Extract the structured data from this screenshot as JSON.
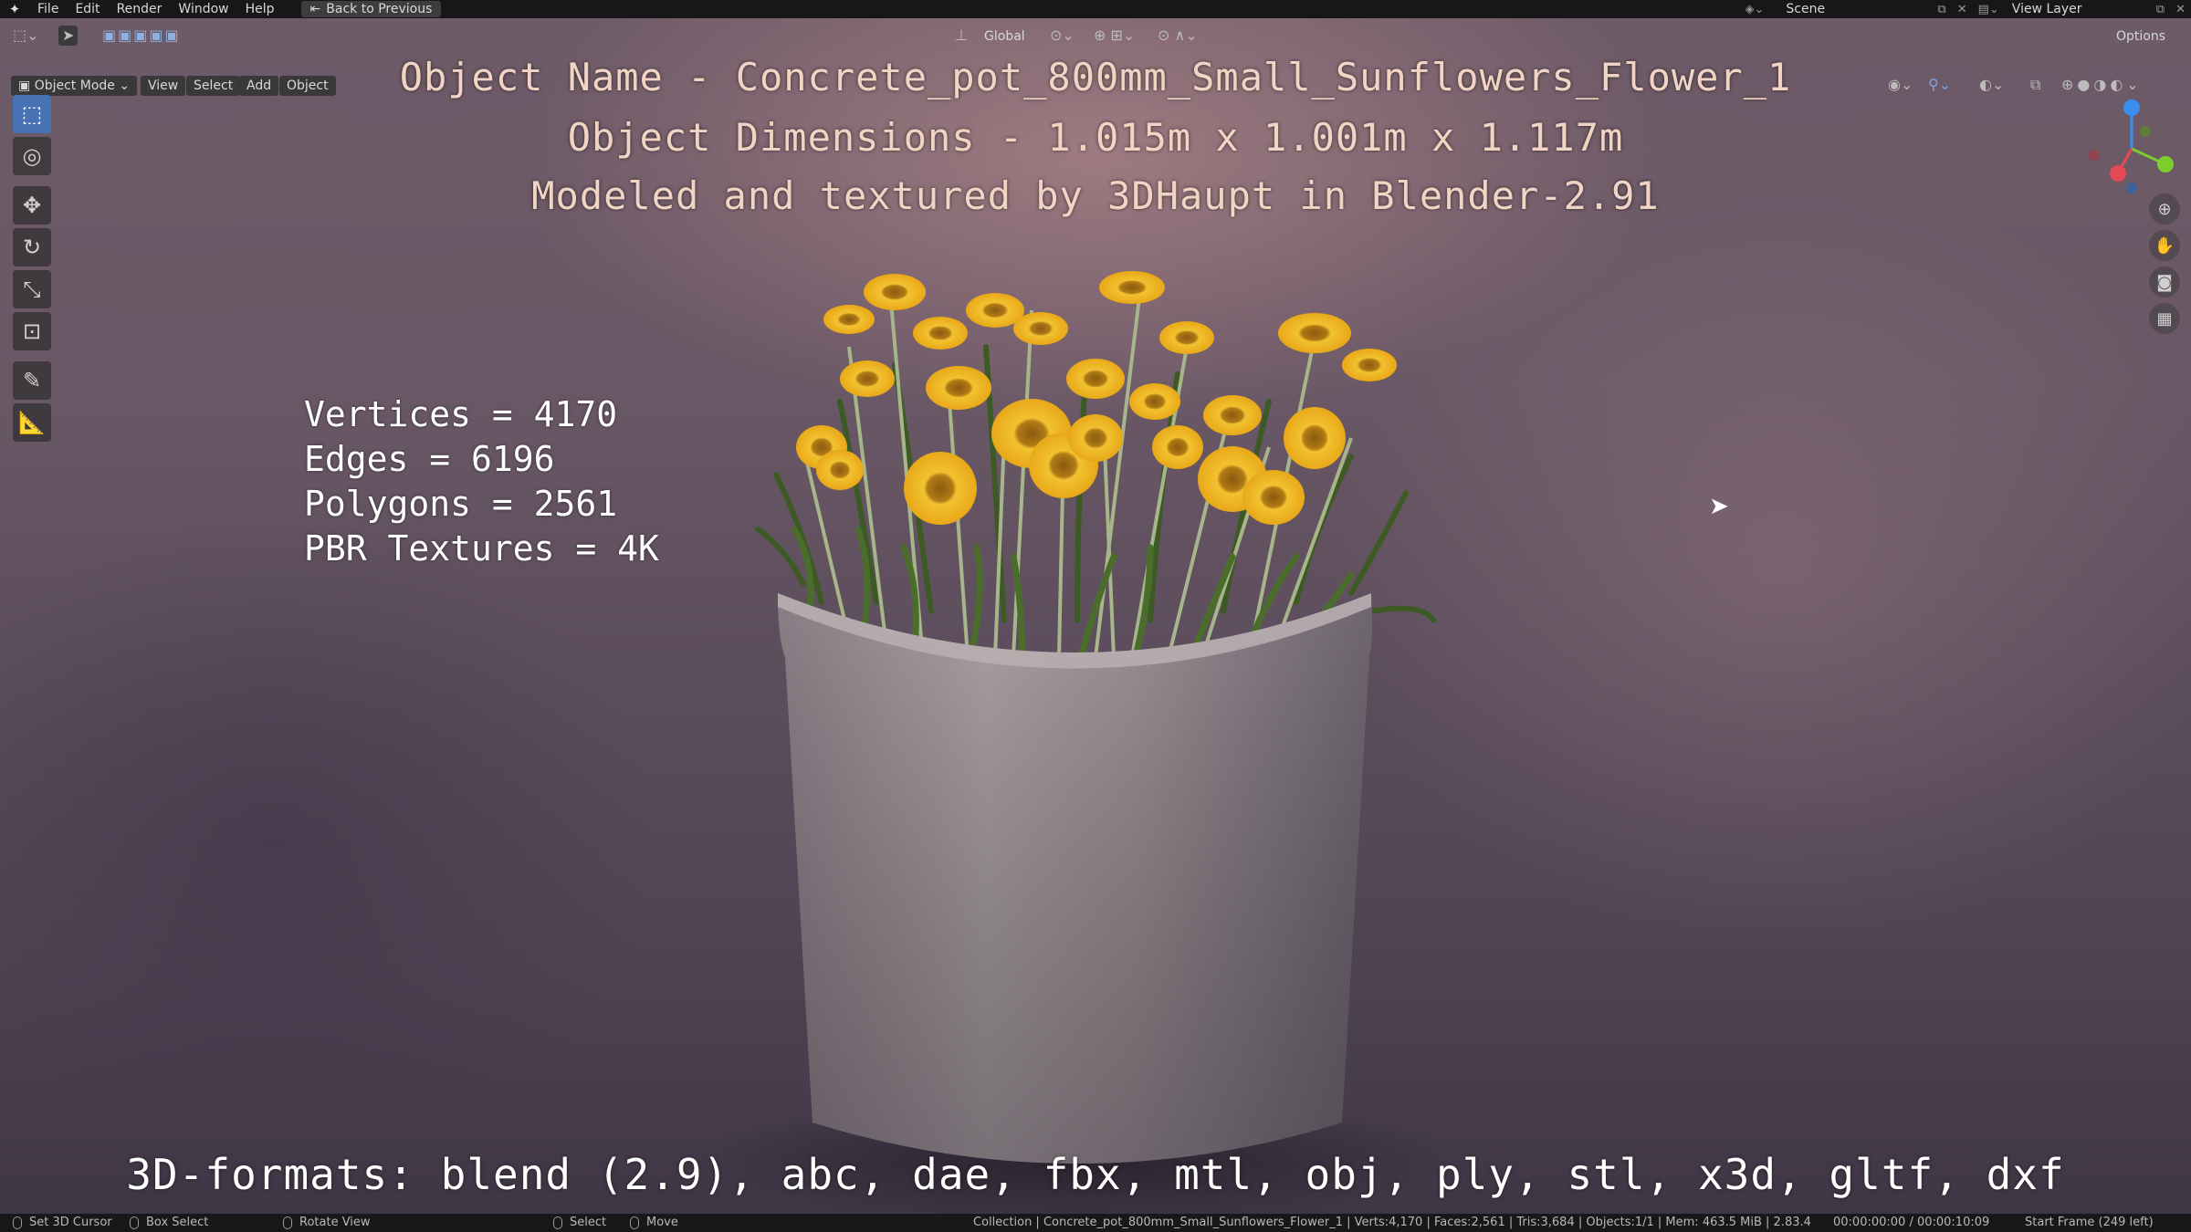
{
  "menu": {
    "items": [
      "File",
      "Edit",
      "Render",
      "Window",
      "Help"
    ],
    "back_button": "Back to Previous",
    "scene_label": "Scene",
    "view_layer_label": "View Layer"
  },
  "header": {
    "mode": "Object Mode",
    "menus": [
      "View",
      "Select",
      "Add",
      "Object"
    ],
    "orientation": "Global",
    "options": "Options"
  },
  "overlay": {
    "object_name": "Object Name - Concrete_pot_800mm_Small_Sunflowers_Flower_1",
    "dimensions": "Object Dimensions -  1.015m x 1.001m x 1.117m",
    "credit": "Modeled and textured by 3DHaupt in Blender-2.91",
    "stats": [
      "Vertices = 4170",
      "Edges = 6196",
      "Polygons = 2561",
      "PBR Textures = 4K"
    ],
    "formats": "3D-formats: blend (2.9), abc, dae, fbx, mtl, obj, ply, stl, x3d, gltf, dxf"
  },
  "statusbar": {
    "set_cursor": "Set 3D Cursor",
    "box_select": "Box Select",
    "rotate_view": "Rotate View",
    "select": "Select",
    "move": "Move",
    "info": "Collection | Concrete_pot_800mm_Small_Sunflowers_Flower_1 | Verts:4,170 | Faces:2,561 | Tris:3,684 | Objects:1/1 | Mem: 463.5 MiB | 2.83.4",
    "time": "00:00:00:00 / 00:00:10:09",
    "start_frame": "Start Frame (249 left)"
  },
  "icons": {
    "logo": "blender-logo",
    "select_box": "select-box-icon",
    "cursor": "cursor-icon",
    "move": "move-icon",
    "rotate": "rotate-icon",
    "scale": "scale-icon",
    "transform": "transform-icon",
    "annotate": "annotate-icon",
    "measure": "measure-icon"
  },
  "colors": {
    "active_tool": "#4772b3",
    "title_text": "#f2d4c4",
    "axis_x": "#e44a55",
    "axis_y": "#7fcc2d",
    "axis_z": "#3a8ef0"
  }
}
